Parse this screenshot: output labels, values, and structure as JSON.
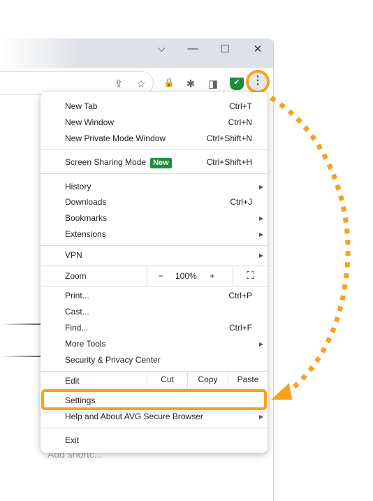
{
  "window": {
    "controls": {
      "tabsearch": "⌵",
      "minimize": "—",
      "maximize": "☐",
      "close": "✕"
    }
  },
  "toolbar": {
    "share": "⇪",
    "star": "☆",
    "lock": "🔒",
    "puzzle": "✱",
    "sidepanel": "◨",
    "shield": "✔",
    "menu": "⋮"
  },
  "page": {
    "add_shortcut": "Add shortc..."
  },
  "menu": {
    "new_tab": {
      "label": "New Tab",
      "shortcut": "Ctrl+T"
    },
    "new_window": {
      "label": "New Window",
      "shortcut": "Ctrl+N"
    },
    "new_private": {
      "label": "New Private Mode Window",
      "shortcut": "Ctrl+Shift+N"
    },
    "screen_sharing": {
      "label": "Screen Sharing Mode",
      "badge": "New",
      "shortcut": "Ctrl+Shift+H"
    },
    "history": {
      "label": "History"
    },
    "downloads": {
      "label": "Downloads",
      "shortcut": "Ctrl+J"
    },
    "bookmarks": {
      "label": "Bookmarks"
    },
    "extensions": {
      "label": "Extensions"
    },
    "vpn": {
      "label": "VPN"
    },
    "zoom": {
      "label": "Zoom",
      "minus": "−",
      "value": "100%",
      "plus": "+",
      "fullscreen": "⛶"
    },
    "print": {
      "label": "Print...",
      "shortcut": "Ctrl+P"
    },
    "cast": {
      "label": "Cast..."
    },
    "find": {
      "label": "Find...",
      "shortcut": "Ctrl+F"
    },
    "more_tools": {
      "label": "More Tools"
    },
    "security": {
      "label": "Security & Privacy Center"
    },
    "edit": {
      "label": "Edit",
      "cut": "Cut",
      "copy": "Copy",
      "paste": "Paste"
    },
    "settings": {
      "label": "Settings"
    },
    "help": {
      "label": "Help and About AVG Secure Browser"
    },
    "exit": {
      "label": "Exit"
    },
    "submenu_arrow": "▶"
  },
  "colors": {
    "highlight": "#f7a21b",
    "badge": "#1e8e3e"
  }
}
